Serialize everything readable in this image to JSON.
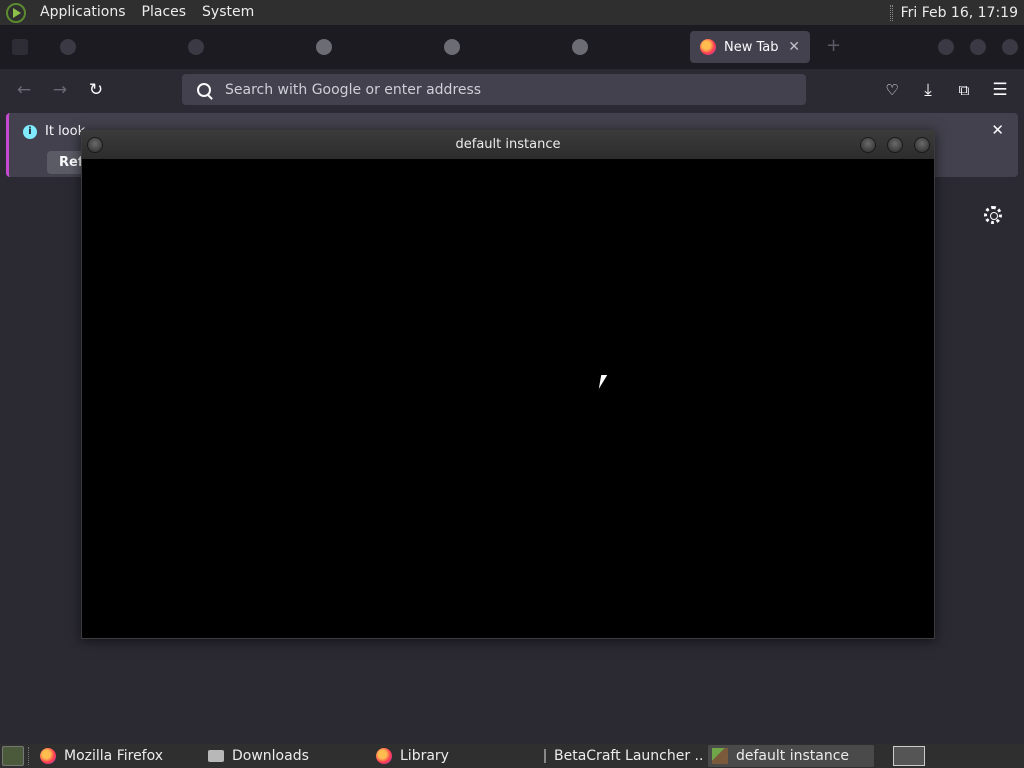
{
  "top_panel": {
    "menus": [
      "Applications",
      "Places",
      "System"
    ],
    "clock": "Fri Feb 16, 17:19"
  },
  "browser": {
    "tabs": [
      {
        "label": "",
        "icon": "app-icon"
      },
      {
        "label": "",
        "icon": "app-icon"
      },
      {
        "label": "",
        "icon": "github-icon"
      },
      {
        "label": "",
        "icon": "github-icon"
      },
      {
        "label": "",
        "icon": "github-icon"
      },
      {
        "label": "New Tab",
        "icon": "firefox-icon",
        "active": true
      }
    ],
    "address_placeholder": "Search with Google or enter address",
    "infobar": {
      "message": "It look",
      "button": "Ref"
    }
  },
  "game_window": {
    "title": "default instance"
  },
  "taskbar": {
    "tasks": [
      {
        "label": "Mozilla Firefox",
        "icon": "firefox-icon"
      },
      {
        "label": "Downloads",
        "icon": "folder-icon"
      },
      {
        "label": "Library",
        "icon": "firefox-icon"
      },
      {
        "label": "BetaCraft Launcher ...",
        "icon": "betacraft-icon"
      },
      {
        "label": "default instance",
        "icon": "minecraft-icon",
        "active": true
      }
    ]
  }
}
